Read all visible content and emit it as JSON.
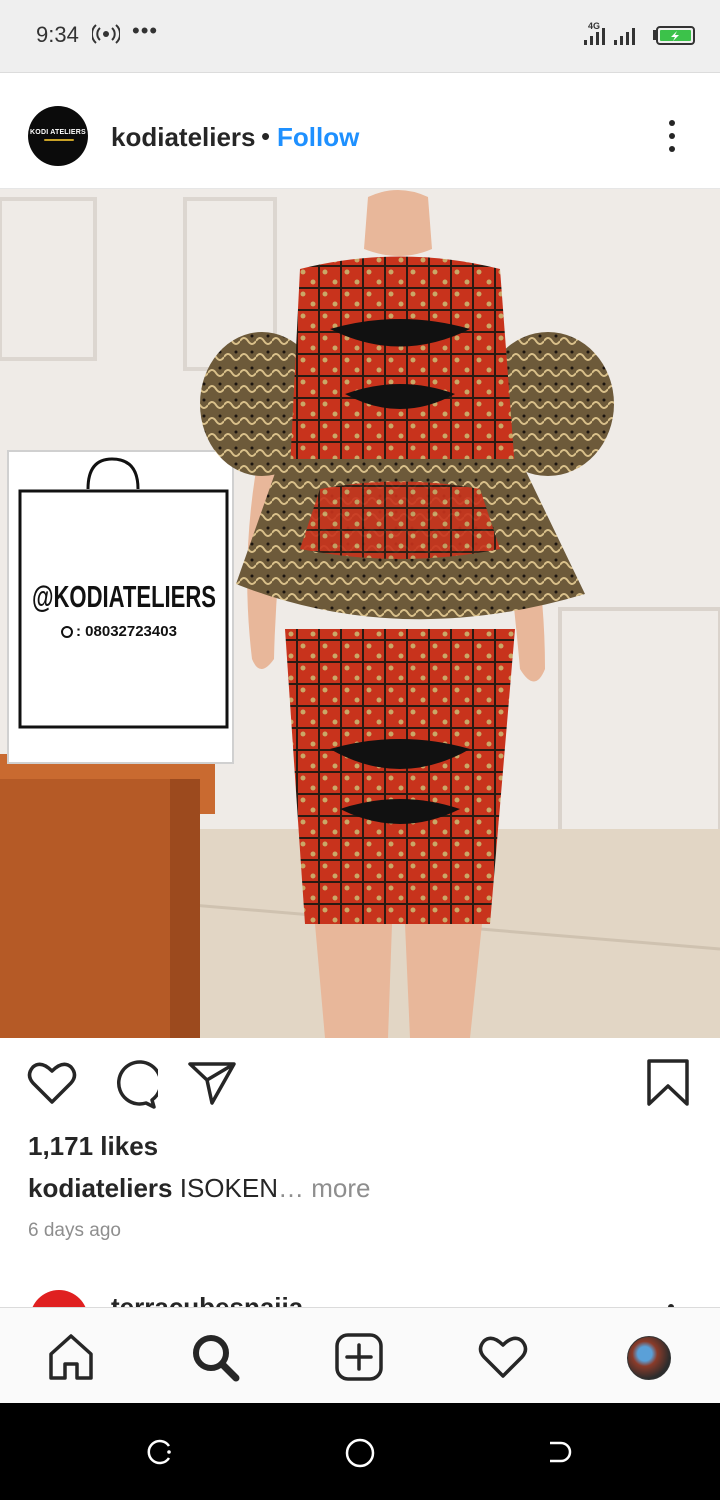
{
  "status_bar": {
    "time": "9:34",
    "network": "4G"
  },
  "post": {
    "avatar_text": "KODI ATELIERS",
    "username": "kodiateliers",
    "separator": "•",
    "follow_label": "Follow",
    "photo": {
      "bag_handle": "@KODIATELIERS",
      "bag_phone": ": 08032723403"
    },
    "likes": "1,171 likes",
    "caption_user": "kodiateliers",
    "caption_text": " ISOKEN",
    "caption_more": "… more",
    "time_ago": "6 days ago"
  },
  "next_post": {
    "username": "terracubesnaija"
  },
  "colors": {
    "follow_blue": "#1e90ff",
    "text": "#262626",
    "muted": "#8e8e8e"
  },
  "icons": {
    "actions": [
      "heart-icon",
      "comment-icon",
      "share-icon",
      "bookmark-icon"
    ],
    "nav": [
      "home-icon",
      "search-icon",
      "add-post-icon",
      "activity-heart-icon",
      "profile-avatar"
    ],
    "system": [
      "recents-icon",
      "home-circle-icon",
      "back-icon"
    ]
  }
}
